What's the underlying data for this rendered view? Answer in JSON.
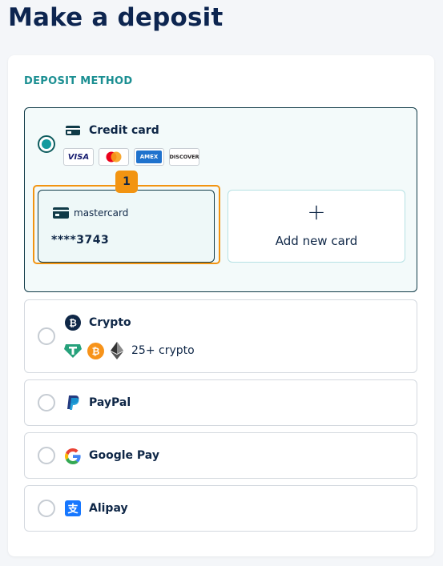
{
  "page": {
    "title": "Make a deposit"
  },
  "section": {
    "label": "DEPOSIT METHOD"
  },
  "methods": {
    "credit_card": {
      "label": "Credit card",
      "selected": true,
      "logos": [
        "VISA",
        "mastercard",
        "AMEX",
        "DISCOVER"
      ],
      "saved_card": {
        "brand": "mastercard",
        "number": "****3743",
        "badge": "1"
      },
      "add_card_label": "Add new card",
      "add_card_icon": "+"
    },
    "crypto": {
      "label": "Crypto",
      "more_label": "25+ crypto",
      "coin_icons": [
        "tether-icon",
        "bitcoin-icon",
        "ethereum-icon"
      ]
    },
    "paypal": {
      "label": "PayPal"
    },
    "google_pay": {
      "label": "Google Pay"
    },
    "alipay": {
      "label": "Alipay"
    }
  },
  "colors": {
    "accent": "#159a9e",
    "highlight": "#f29411",
    "title": "#0d2550",
    "section_label": "#1b8f92"
  }
}
